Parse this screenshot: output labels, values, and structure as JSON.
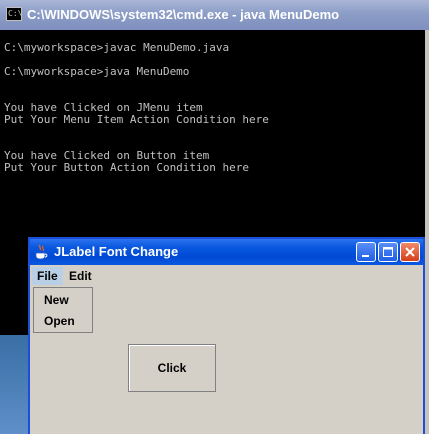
{
  "console": {
    "title": "C:\\WINDOWS\\system32\\cmd.exe - java MenuDemo",
    "icon_text": "C:\\",
    "lines": [
      "C:\\myworkspace>javac MenuDemo.java",
      "",
      "C:\\myworkspace>java MenuDemo",
      "",
      "",
      "You have Clicked on JMenu item",
      "Put Your Menu Item Action Condition here",
      "",
      "",
      "You have Clicked on Button item",
      "Put Your Button Action Condition here"
    ]
  },
  "jframe": {
    "title": "JLabel Font Change",
    "menus": [
      "File",
      "Edit"
    ],
    "file_menu_items": [
      "New",
      "Open"
    ],
    "button_label": "Click"
  },
  "colors": {
    "console_bg": "#000000",
    "console_text": "#c0c0c0",
    "xp_title_blue": "#0a59e0",
    "menu_highlight": "#b8cfe5"
  }
}
